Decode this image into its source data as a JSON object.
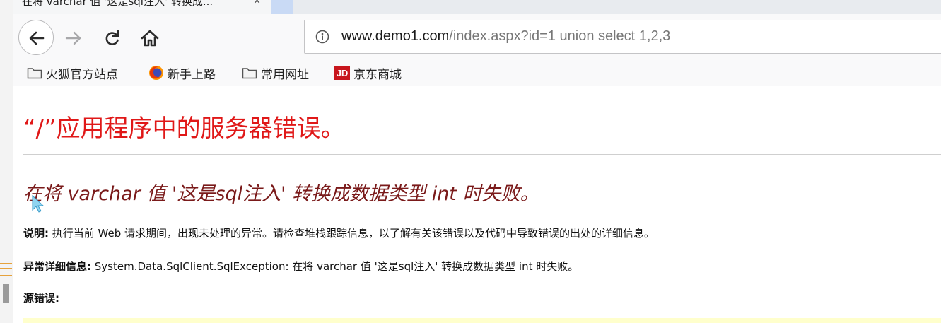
{
  "tab": {
    "title": "在将 varchar 值 '这是sql注入' 转换成...",
    "close": "×"
  },
  "nav": {
    "url_host": "www.demo1.com",
    "url_path": "/index.aspx?id=1 union select 1,2,3"
  },
  "bookmarks": [
    {
      "label": "火狐官方站点",
      "icon": "folder-icon"
    },
    {
      "label": "新手上路",
      "icon": "firefox-icon"
    },
    {
      "label": "常用网址",
      "icon": "folder-icon"
    },
    {
      "label": "京东商城",
      "icon": "jd-icon",
      "icon_text": "JD"
    }
  ],
  "content": {
    "title": "“/”应用程序中的服务器错误。",
    "error_heading": "在将 varchar 值 '这是sql注入' 转换成数据类型 int 时失败。",
    "description_label": "说明:",
    "description_text": " 执行当前 Web 请求期间，出现未处理的异常。请检查堆栈跟踪信息，以了解有关该错误以及代码中导致错误的出处的详细信息。",
    "exception_label": "异常详细信息:",
    "exception_text": " System.Data.SqlClient.SqlException: 在将 varchar 值 '这是sql注入' 转换成数据类型 int 时失败。",
    "source_label": "源错误:"
  },
  "colors": {
    "title_red": "#e01818",
    "heading_maroon": "#7a1a1a",
    "source_box_bg": "#ffffcc",
    "jd_red": "#c8161d"
  }
}
